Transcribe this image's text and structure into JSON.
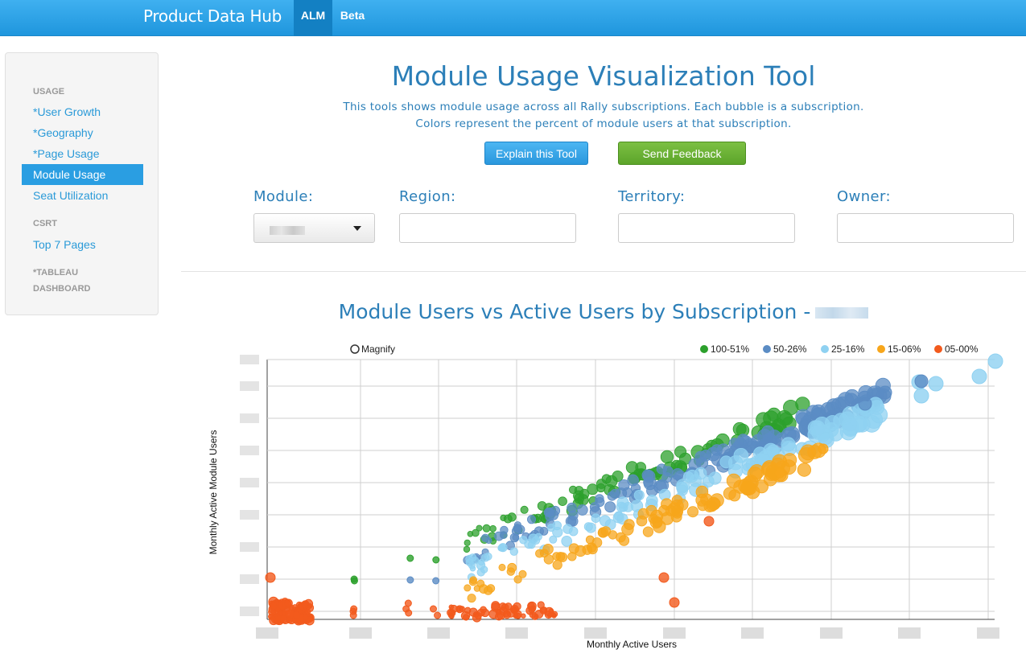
{
  "app": {
    "title": "Product Data Hub",
    "tabs": [
      {
        "label": "ALM",
        "active": true
      },
      {
        "label": "Beta",
        "active": false
      }
    ]
  },
  "sidebar": {
    "sections": [
      {
        "heading": "USAGE",
        "items": [
          {
            "label": "*User Growth",
            "active": false
          },
          {
            "label": "*Geography",
            "active": false
          },
          {
            "label": "*Page Usage",
            "active": false
          },
          {
            "label": "Module Usage",
            "active": true
          },
          {
            "label": "Seat Utilization",
            "active": false
          }
        ]
      },
      {
        "heading": "CSRT",
        "items": [
          {
            "label": "Top 7 Pages",
            "active": false
          }
        ]
      },
      {
        "heading": "*TABLEAU DASHBOARD",
        "heading_lines": [
          "*TABLEAU",
          "DASHBOARD"
        ],
        "items": []
      }
    ]
  },
  "main": {
    "title": "Module Usage Visualization Tool",
    "subtitle_lines": [
      "This tools shows module usage across all Rally subscriptions. Each bubble is a subscription.",
      "Colors represent the percent of module users at that subscription."
    ],
    "buttons": {
      "explain": "Explain this Tool",
      "feedback": "Send Feedback"
    },
    "filters": {
      "module": "Module:",
      "region": "Region:",
      "territory": "Territory:",
      "owner": "Owner:"
    },
    "chart_title": "Module Users vs Active Users by Subscription -"
  },
  "chart_data": {
    "type": "scatter",
    "title": "Module Users vs Active Users by Subscription -",
    "xlabel": "Monthly Active Users",
    "ylabel": "Monthly Active Module Users",
    "x_tick_labels_redacted": true,
    "y_tick_labels_redacted": true,
    "grid": true,
    "magnify_label": "Magnify",
    "legend_placement": "top-right",
    "series": [
      {
        "name": "100-51%",
        "color": "#2ca02c"
      },
      {
        "name": "50-26%",
        "color": "#5b8cc4"
      },
      {
        "name": "25-16%",
        "color": "#8fd1f1"
      },
      {
        "name": "15-06%",
        "color": "#f7a61b"
      },
      {
        "name": "05-00%",
        "color": "#f25a1d"
      }
    ]
  }
}
